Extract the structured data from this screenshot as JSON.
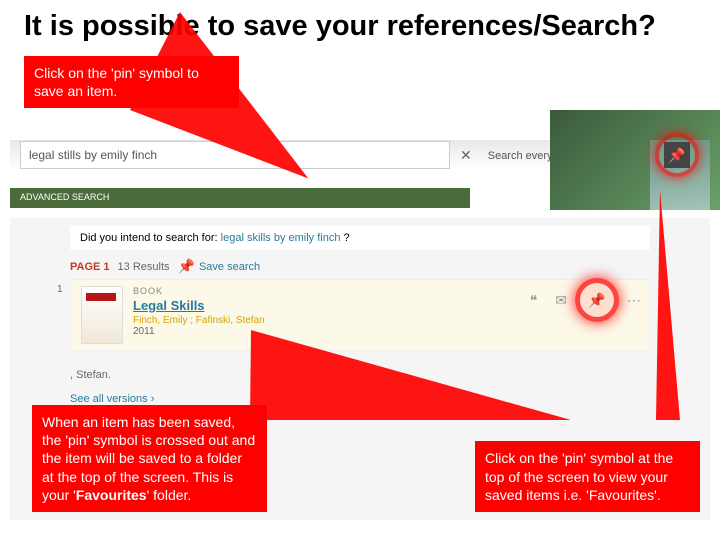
{
  "title": "It is possible to save your references/Search?",
  "callouts": {
    "top_left": "Click on the 'pin' symbol to save an item.",
    "bottom_left_p1": "When an item has been saved, the 'pin' symbol is crossed out and the item will be saved to a folder at the top of the screen. This is your '",
    "bottom_left_bold": "Favourites",
    "bottom_left_p2": "' folder.",
    "bottom_right": "Click on the 'pin' symbol at the top of the screen to view your saved items i.e. 'Favourites'."
  },
  "search": {
    "query": "legal stills by emily finch",
    "scope": "Search everything",
    "advanced": "ADVANCED SEARCH"
  },
  "suggest": {
    "prefix": "Did you intend to search for: ",
    "suggestion": "legal skills by emily finch",
    "suffix": " ?"
  },
  "page": {
    "label": "PAGE 1",
    "count": "13 Results",
    "save": "Save search"
  },
  "result": {
    "index": "1",
    "type": "BOOK",
    "title": "Legal Skills",
    "authors": "Finch, Emily ; Fafinski, Stefan",
    "year": "2011"
  },
  "lower": {
    "authors_frag": ", Stefan.",
    "versions": "See all versions ›"
  },
  "icons": {
    "pin": "📌",
    "search": "🔍",
    "quote": "❝",
    "mail": "✉",
    "clear": "✕",
    "dropdown": "▾",
    "chevron": "›"
  }
}
